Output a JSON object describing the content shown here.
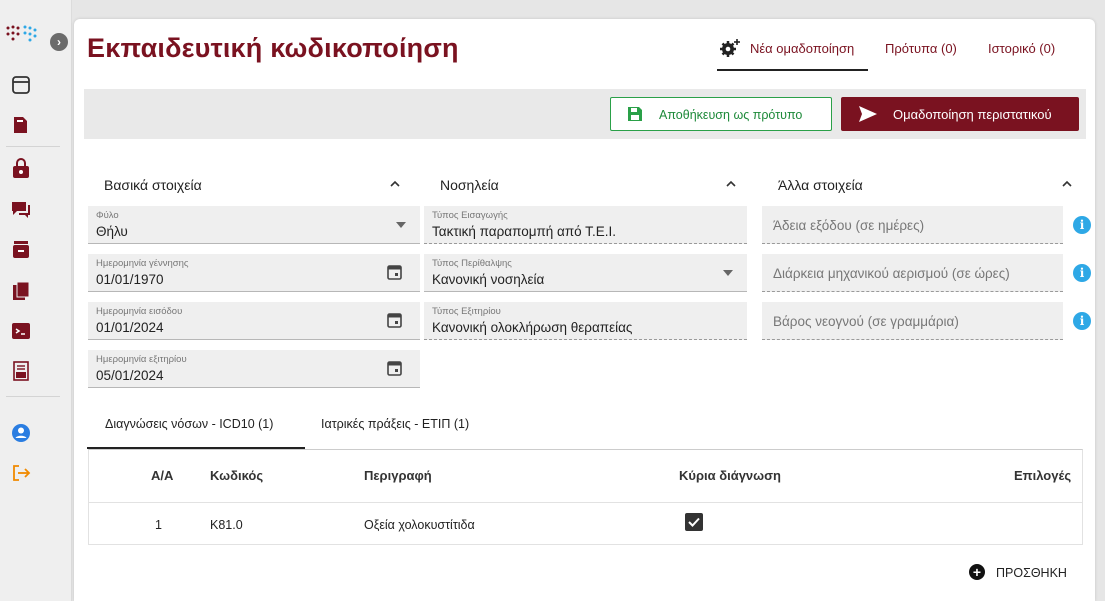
{
  "app": {
    "title": "Εκπαιδευτική κωδικοποίηση"
  },
  "top_tabs": [
    {
      "label": "Νέα ομαδοποίηση",
      "active": true
    },
    {
      "label": "Πρότυπα (0)"
    },
    {
      "label": "Ιστορικό (0)"
    }
  ],
  "toolbar": {
    "save_label": "Αποθήκευση ως πρότυπο",
    "group_label": "Ομαδοποίηση περιστατικού"
  },
  "sections": {
    "basic": "Βασικά στοιχεία",
    "hospitalization": "Νοσηλεία",
    "other": "Άλλα στοιχεία"
  },
  "basic_fields": [
    {
      "label": "Φύλο",
      "value": "Θήλυ",
      "control": "dropdown"
    },
    {
      "label": "Ημερομηνία γέννησης",
      "value": "01/01/1970",
      "control": "date"
    },
    {
      "label": "Ημερομηνία εισόδου",
      "value": "01/01/2024",
      "control": "date"
    },
    {
      "label": "Ημερομηνία εξιτηρίου",
      "value": "05/01/2024",
      "control": "date"
    }
  ],
  "hosp_fields": [
    {
      "label": "Τύπος Εισαγωγής",
      "value": "Τακτική παραπομπή από Τ.Ε.Ι."
    },
    {
      "label": "Τύπος Περίθαλψης",
      "value": "Κανονική νοσηλεία",
      "control": "dropdown"
    },
    {
      "label": "Τύπος Εξιτηρίου",
      "value": "Κανονική ολοκλήρωση θεραπείας"
    }
  ],
  "other_fields": [
    {
      "placeholder": "Άδεια εξόδου (σε ημέρες)"
    },
    {
      "placeholder": "Διάρκεια μηχανικού αερισμού (σε ώρες)"
    },
    {
      "placeholder": "Βάρος νεογνού (σε γραμμάρια)"
    }
  ],
  "bottom_tabs": [
    {
      "label": "Διαγνώσεις νόσων - ICD10 (1)",
      "active": true
    },
    {
      "label": "Ιατρικές πράξεις - ΕΤΙΠ (1)"
    }
  ],
  "table": {
    "headers": [
      "Α/Α",
      "Κωδικός",
      "Περιγραφή",
      "Κύρια διάγνωση",
      "Επιλογές"
    ],
    "rows": [
      {
        "aa": "1",
        "code": "K81.0",
        "description": "Οξεία χολοκυστίτιδα",
        "primary": true
      }
    ]
  },
  "add_label": "ΠΡΟΣΘΗΚΗ",
  "colors": {
    "brand": "#7a1220",
    "save_green": "#2aa048",
    "info_blue": "#2ea8e6"
  }
}
